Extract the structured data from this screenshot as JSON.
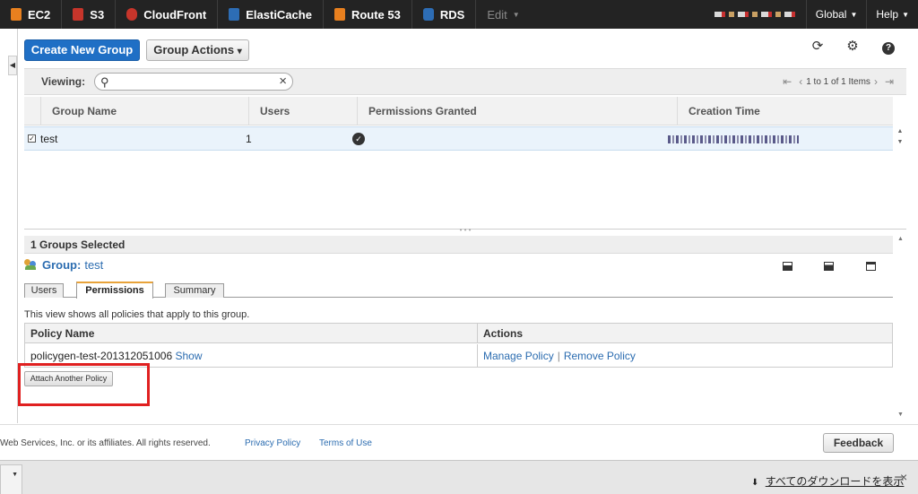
{
  "nav": {
    "services": [
      {
        "label": "EC2",
        "icon": "ec2-icon",
        "color": "#e8801f"
      },
      {
        "label": "S3",
        "icon": "s3-icon",
        "color": "#c7352b"
      },
      {
        "label": "CloudFront",
        "icon": "cloudfront-icon",
        "color": "#c7352b"
      },
      {
        "label": "ElastiCache",
        "icon": "elasticache-icon",
        "color": "#2d6db5"
      },
      {
        "label": "Route 53",
        "icon": "route53-icon",
        "color": "#e8801f"
      },
      {
        "label": "RDS",
        "icon": "rds-icon",
        "color": "#2d6db5"
      }
    ],
    "edit_label": "Edit",
    "region_label": "Global",
    "help_label": "Help"
  },
  "toolbar": {
    "create_label": "Create New Group",
    "actions_label": "Group Actions",
    "actions_caret": "⌄"
  },
  "filter": {
    "viewing_label": "Viewing:",
    "search_value": "",
    "pager_text": "1 to 1 of 1 Items"
  },
  "table": {
    "headers": [
      "Group Name",
      "Users",
      "Permissions Granted",
      "Creation Time"
    ],
    "rows": [
      {
        "name": "test",
        "users": "1"
      }
    ]
  },
  "detail": {
    "selected_label": "1 Groups Selected",
    "group_label": "Group:",
    "group_name": "test",
    "tabs": [
      "Users",
      "Permissions",
      "Summary"
    ],
    "active_tab": "Permissions",
    "description": "This view shows all policies that apply to this group.",
    "policy_headers": [
      "Policy Name",
      "Actions"
    ],
    "policies": [
      {
        "name": "policygen-test-201312051006",
        "show_label": "Show",
        "manage_label": "Manage Policy",
        "remove_label": "Remove Policy",
        "separator": "|"
      }
    ],
    "attach_label": "Attach Another Policy",
    "highlight_color": "#e02020"
  },
  "footer": {
    "copyright": "Web Services, Inc. or its affiliates. All rights reserved.",
    "privacy_label": "Privacy Policy",
    "terms_label": "Terms of Use",
    "feedback_label": "Feedback"
  },
  "downloads": {
    "show_all_label": "すべてのダウンロードを表示",
    "close_label": "×"
  }
}
